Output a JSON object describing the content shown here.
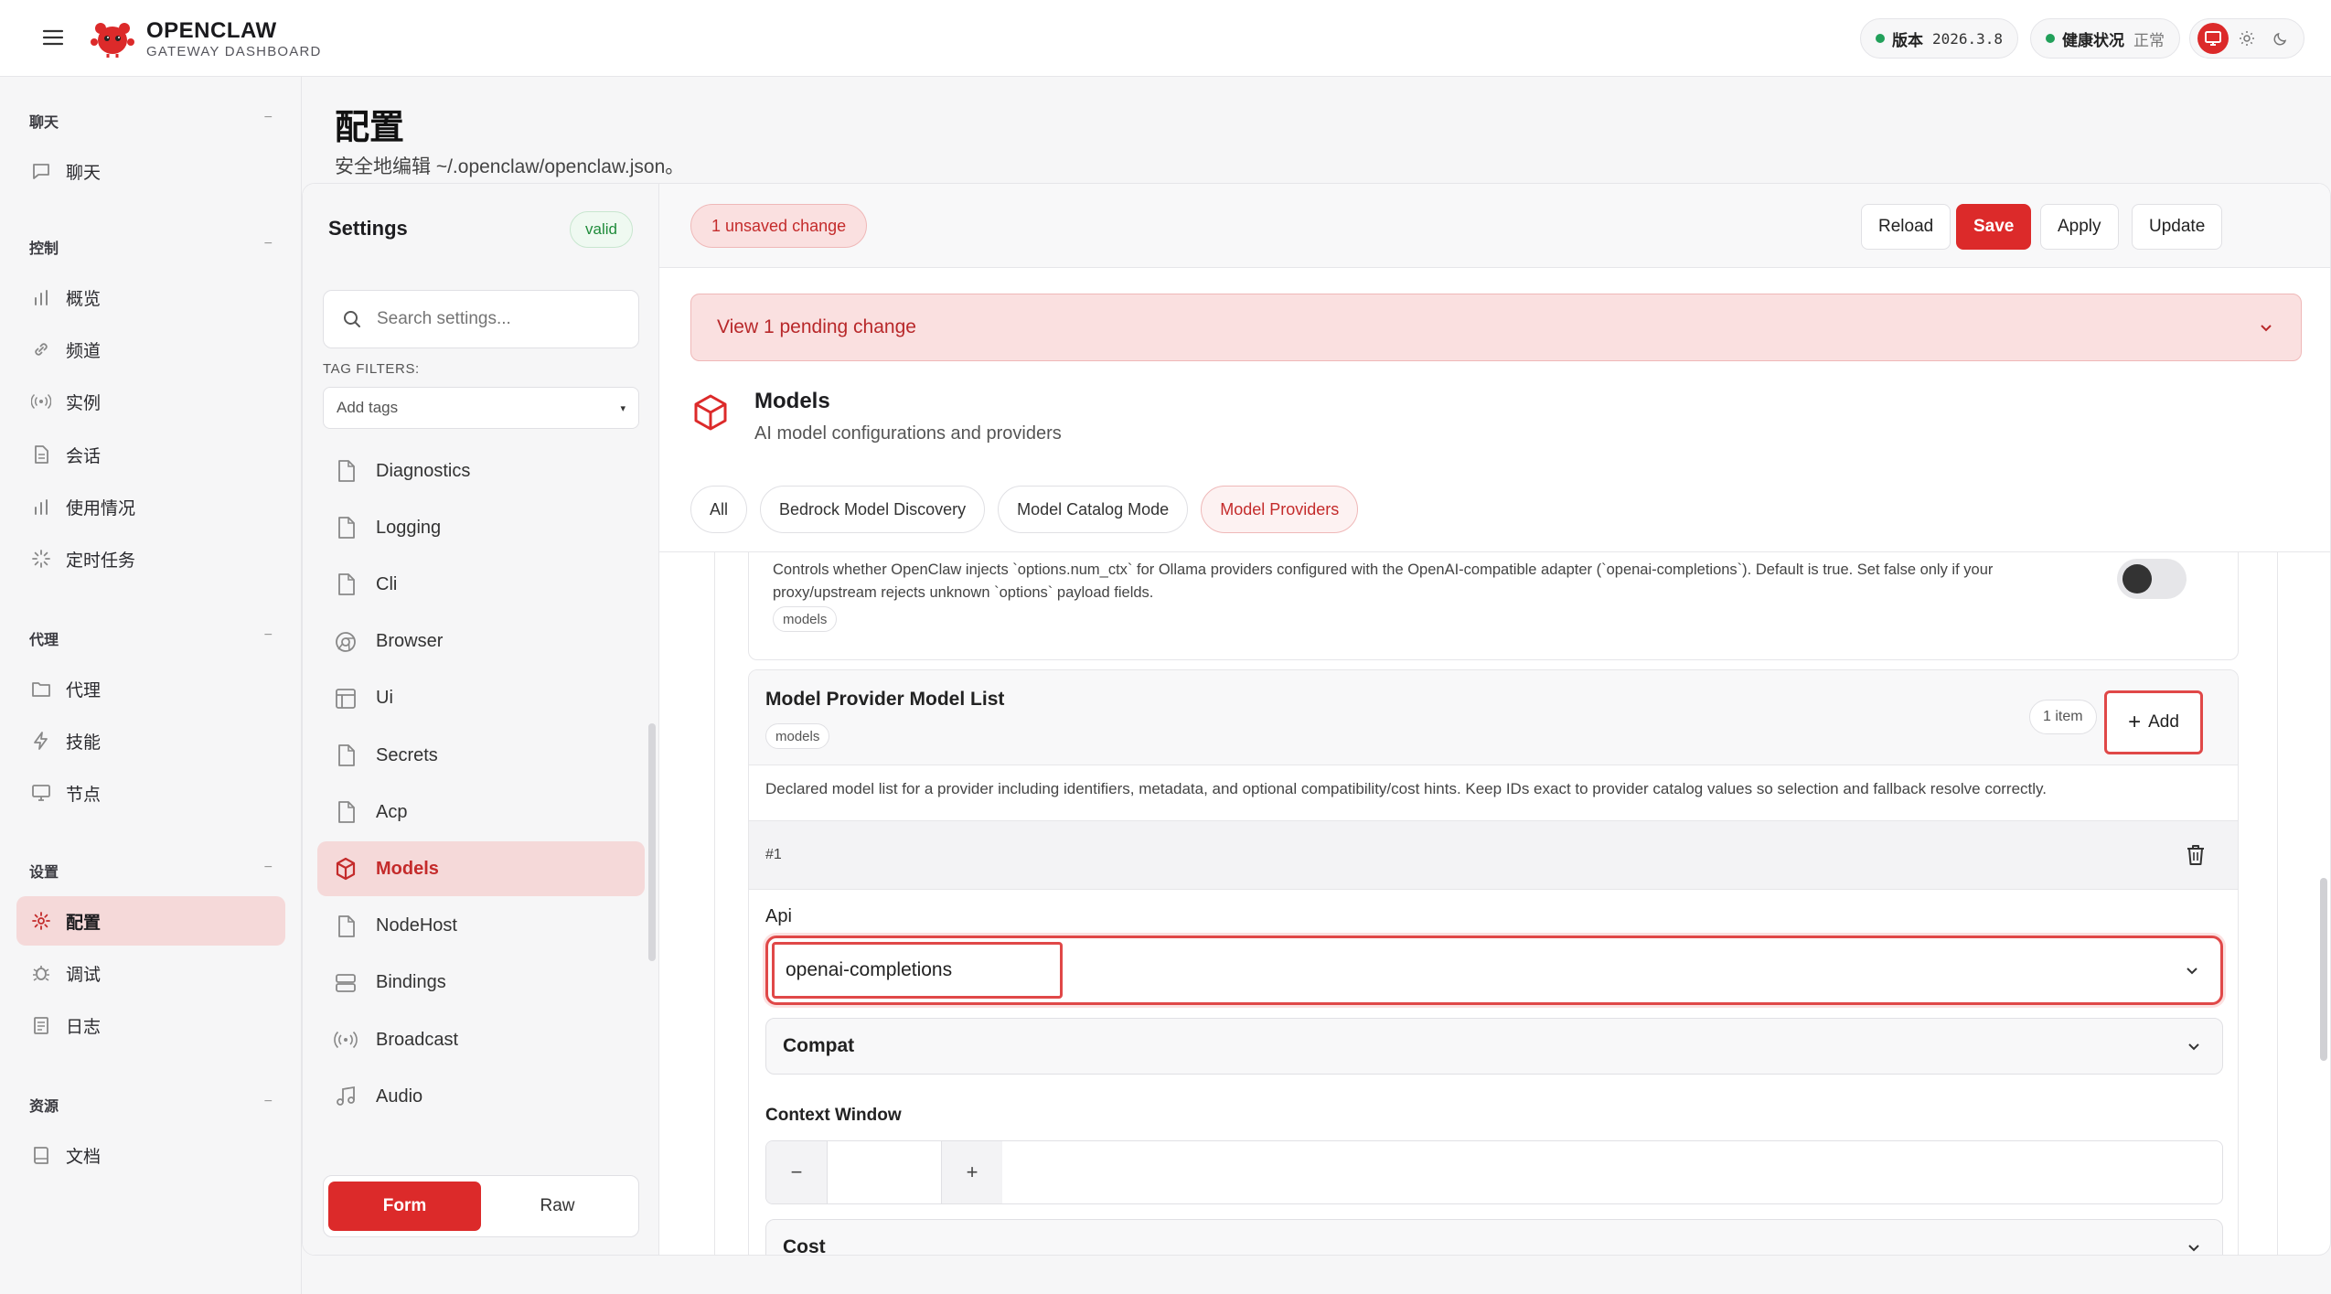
{
  "app": {
    "name": "OPENCLAW",
    "subtitle": "GATEWAY DASHBOARD"
  },
  "status": {
    "version_label": "版本",
    "version_value": "2026.3.8",
    "health_label": "健康状况",
    "health_value": "正常",
    "health_color": "#22a05a"
  },
  "colors": {
    "accent": "#dc2a2a",
    "accent_soft": "#f5d9d9"
  },
  "sidebar": {
    "groups": [
      {
        "label": "聊天",
        "items": [
          {
            "label": "聊天",
            "icon": "chat-icon"
          }
        ]
      },
      {
        "label": "控制",
        "items": [
          {
            "label": "概览",
            "icon": "bar-chart-icon"
          },
          {
            "label": "频道",
            "icon": "link-icon"
          },
          {
            "label": "实例",
            "icon": "broadcast-icon"
          },
          {
            "label": "会话",
            "icon": "document-icon"
          },
          {
            "label": "使用情况",
            "icon": "bar-chart-icon"
          },
          {
            "label": "定时任务",
            "icon": "loader-icon"
          }
        ]
      },
      {
        "label": "代理",
        "items": [
          {
            "label": "代理",
            "icon": "folder-icon"
          },
          {
            "label": "技能",
            "icon": "bolt-icon"
          },
          {
            "label": "节点",
            "icon": "monitor-icon"
          }
        ]
      },
      {
        "label": "设置",
        "items": [
          {
            "label": "配置",
            "icon": "gear-icon"
          },
          {
            "label": "调试",
            "icon": "bug-icon"
          },
          {
            "label": "日志",
            "icon": "log-icon"
          }
        ]
      },
      {
        "label": "资源",
        "items": [
          {
            "label": "文档",
            "icon": "book-icon"
          }
        ]
      }
    ],
    "collapse_symbol": "−"
  },
  "page": {
    "title": "配置",
    "subtitle": "安全地编辑 ~/.openclaw/openclaw.json。"
  },
  "settings": {
    "title": "Settings",
    "valid_badge": "valid",
    "search_placeholder": "Search settings...",
    "tag_filters_label": "TAG FILTERS:",
    "tag_placeholder": "Add tags",
    "sections": [
      "Diagnostics",
      "Logging",
      "Cli",
      "Browser",
      "Ui",
      "Secrets",
      "Acp",
      "Models",
      "NodeHost",
      "Bindings",
      "Broadcast",
      "Audio"
    ],
    "active_section": "Models",
    "modes": [
      "Form",
      "Raw"
    ],
    "active_mode": "Form"
  },
  "toolbar": {
    "unsaved": "1 unsaved change",
    "reload": "Reload",
    "save": "Save",
    "apply": "Apply",
    "update": "Update"
  },
  "pending": {
    "label": "View 1 pending change"
  },
  "models": {
    "title": "Models",
    "subtitle": "AI model configurations and providers",
    "tabs": [
      "All",
      "Bedrock Model Discovery",
      "Model Catalog Mode",
      "Model Providers"
    ],
    "active_tab": "Model Providers"
  },
  "prev_field": {
    "description": "Controls whether OpenClaw injects `options.num_ctx` for Ollama providers configured with the OpenAI-compatible adapter (`openai-completions`). Default is true. Set false only if your proxy/upstream rejects unknown `options` payload fields.",
    "tag": "models",
    "toggle_on": false
  },
  "model_list": {
    "title": "Model Provider Model List",
    "tag": "models",
    "count": "1 item",
    "add_label": "Add",
    "description": "Declared model list for a provider including identifiers, metadata, and optional compatibility/cost hints. Keep IDs exact to provider catalog values so selection and fallback resolve correctly.",
    "item": {
      "index": "#1",
      "api_label": "Api",
      "api_value": "openai-completions",
      "compat_label": "Compat",
      "context_window_label": "Context Window",
      "context_window_value": "",
      "minus": "−",
      "plus": "+",
      "cost_label": "Cost"
    }
  }
}
